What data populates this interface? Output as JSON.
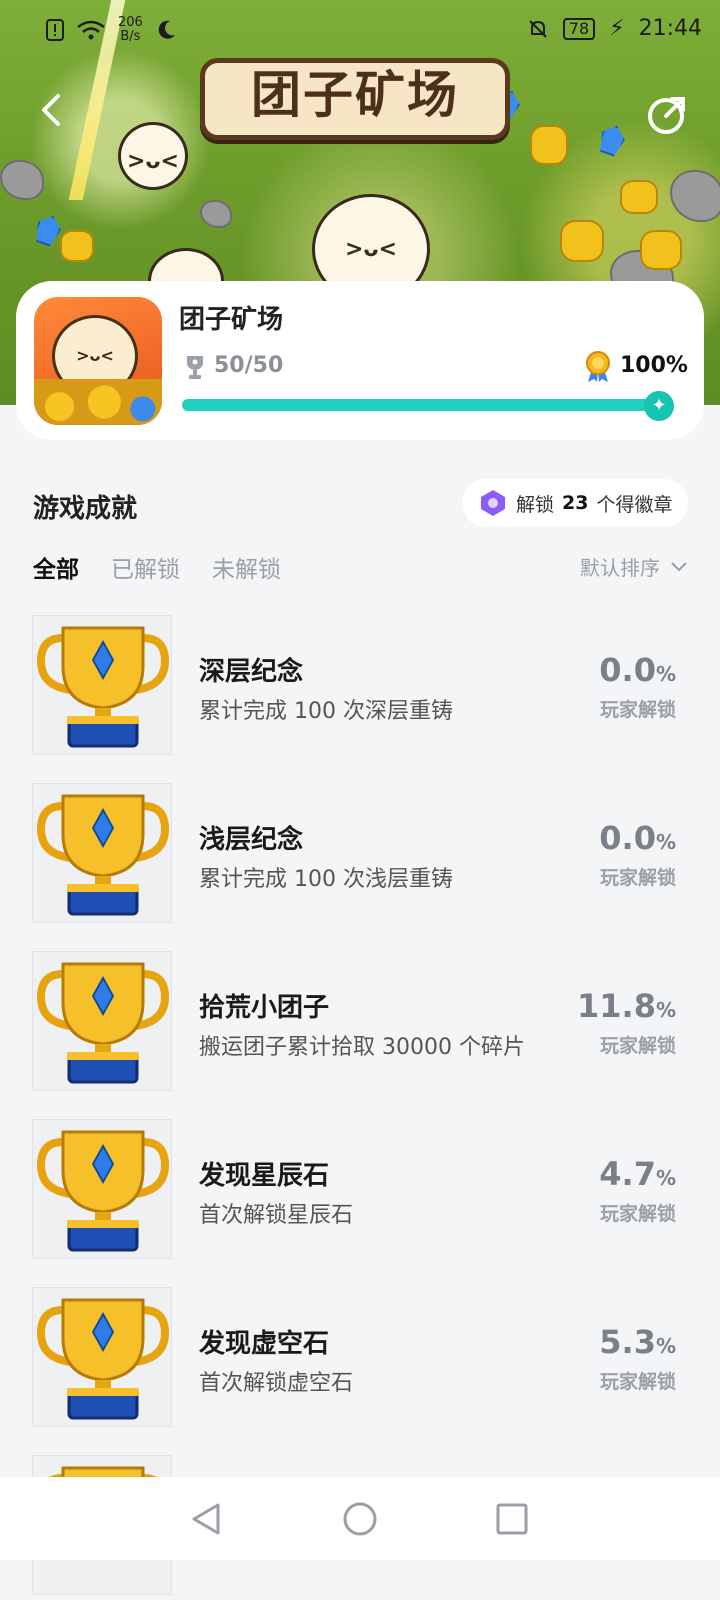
{
  "status_bar": {
    "net_speed": "206",
    "net_unit": "B/s",
    "battery": "78",
    "time": "21:44"
  },
  "header": {
    "banner_title": "团子矿场"
  },
  "game": {
    "name": "团子矿场",
    "achievements_done": "50/50",
    "completion": "100%",
    "completion_value": 1.0
  },
  "section": {
    "title": "游戏成就",
    "badge_prefix": "解锁",
    "badge_count": "23",
    "badge_suffix": "个得徽章"
  },
  "tabs": [
    "全部",
    "已解锁",
    "未解锁"
  ],
  "sort_label": "默认排序",
  "rate_label": "玩家解锁",
  "achievements": [
    {
      "name": "深层纪念",
      "desc": "累计完成 100 次深层重铸",
      "rate": "0.0",
      "unit": "%"
    },
    {
      "name": "浅层纪念",
      "desc": "累计完成 100 次浅层重铸",
      "rate": "0.0",
      "unit": "%"
    },
    {
      "name": "拾荒小团子",
      "desc": "搬运团子累计拾取 30000 个碎片",
      "rate": "11.8",
      "unit": "%"
    },
    {
      "name": "发现星辰石",
      "desc": "首次解锁星辰石",
      "rate": "4.7",
      "unit": "%"
    },
    {
      "name": "发现虚空石",
      "desc": "首次解锁虚空石",
      "rate": "5.3",
      "unit": "%"
    }
  ],
  "colors": {
    "accent": "#21d1bd",
    "background": "#f4f5f7",
    "trophy_gold": "#f2b51d",
    "trophy_blue": "#1f4fb5"
  }
}
